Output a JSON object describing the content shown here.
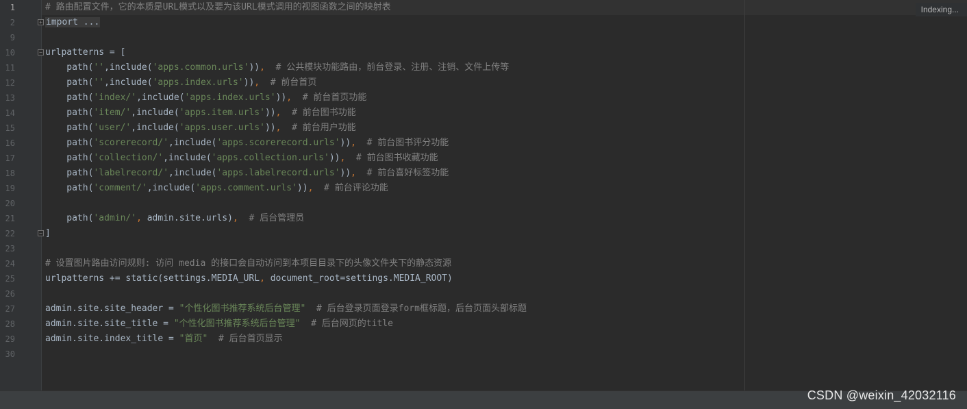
{
  "editor": {
    "line_numbers": [
      "1",
      "2",
      "9",
      "10",
      "11",
      "12",
      "13",
      "14",
      "15",
      "16",
      "17",
      "18",
      "19",
      "20",
      "21",
      "22",
      "23",
      "24",
      "25",
      "26",
      "27",
      "28",
      "29",
      "30"
    ],
    "lines": [
      [
        {
          "c": "cm",
          "t": "# 路由配置文件，它的本质是URL模式以及要为该URL模式调用的视图函数之间的映射表"
        }
      ],
      [
        {
          "c": "import-fold",
          "t": "import ..."
        }
      ],
      [],
      [
        {
          "c": "txt",
          "t": "urlpatterns = ["
        }
      ],
      [
        {
          "c": "txt",
          "t": "    path("
        },
        {
          "c": "str",
          "t": "''"
        },
        {
          "c": "txt",
          "t": ",include("
        },
        {
          "c": "str",
          "t": "'apps.common.urls'"
        },
        {
          "c": "txt",
          "t": "))"
        },
        {
          "c": "kw",
          "t": ","
        },
        {
          "c": "txt",
          "t": "  "
        },
        {
          "c": "cm",
          "t": "# 公共模块功能路由，前台登录、注册、注销、文件上传等"
        }
      ],
      [
        {
          "c": "txt",
          "t": "    path("
        },
        {
          "c": "str",
          "t": "''"
        },
        {
          "c": "txt",
          "t": ",include("
        },
        {
          "c": "str",
          "t": "'apps.index.urls'"
        },
        {
          "c": "txt",
          "t": "))"
        },
        {
          "c": "kw",
          "t": ","
        },
        {
          "c": "txt",
          "t": "  "
        },
        {
          "c": "cm",
          "t": "# 前台首页"
        }
      ],
      [
        {
          "c": "txt",
          "t": "    path("
        },
        {
          "c": "str",
          "t": "'index/'"
        },
        {
          "c": "txt",
          "t": ",include("
        },
        {
          "c": "str",
          "t": "'apps.index.urls'"
        },
        {
          "c": "txt",
          "t": "))"
        },
        {
          "c": "kw",
          "t": ","
        },
        {
          "c": "txt",
          "t": "  "
        },
        {
          "c": "cm",
          "t": "# 前台首页功能"
        }
      ],
      [
        {
          "c": "txt",
          "t": "    path("
        },
        {
          "c": "str",
          "t": "'item/'"
        },
        {
          "c": "txt",
          "t": ",include("
        },
        {
          "c": "str",
          "t": "'apps.item.urls'"
        },
        {
          "c": "txt",
          "t": "))"
        },
        {
          "c": "kw",
          "t": ","
        },
        {
          "c": "txt",
          "t": "  "
        },
        {
          "c": "cm",
          "t": "# 前台图书功能"
        }
      ],
      [
        {
          "c": "txt",
          "t": "    path("
        },
        {
          "c": "str",
          "t": "'user/'"
        },
        {
          "c": "txt",
          "t": ",include("
        },
        {
          "c": "str",
          "t": "'apps.user.urls'"
        },
        {
          "c": "txt",
          "t": "))"
        },
        {
          "c": "kw",
          "t": ","
        },
        {
          "c": "txt",
          "t": "  "
        },
        {
          "c": "cm",
          "t": "# 前台用户功能"
        }
      ],
      [
        {
          "c": "txt",
          "t": "    path("
        },
        {
          "c": "str",
          "t": "'scorerecord/'"
        },
        {
          "c": "txt",
          "t": ",include("
        },
        {
          "c": "str",
          "t": "'apps.scorerecord.urls'"
        },
        {
          "c": "txt",
          "t": "))"
        },
        {
          "c": "kw",
          "t": ","
        },
        {
          "c": "txt",
          "t": "  "
        },
        {
          "c": "cm",
          "t": "# 前台图书评分功能"
        }
      ],
      [
        {
          "c": "txt",
          "t": "    path("
        },
        {
          "c": "str",
          "t": "'collection/'"
        },
        {
          "c": "txt",
          "t": ",include("
        },
        {
          "c": "str",
          "t": "'apps.collection.urls'"
        },
        {
          "c": "txt",
          "t": "))"
        },
        {
          "c": "kw",
          "t": ","
        },
        {
          "c": "txt",
          "t": "  "
        },
        {
          "c": "cm",
          "t": "# 前台图书收藏功能"
        }
      ],
      [
        {
          "c": "txt",
          "t": "    path("
        },
        {
          "c": "str",
          "t": "'labelrecord/'"
        },
        {
          "c": "txt",
          "t": ",include("
        },
        {
          "c": "str",
          "t": "'apps.labelrecord.urls'"
        },
        {
          "c": "txt",
          "t": "))"
        },
        {
          "c": "kw",
          "t": ","
        },
        {
          "c": "txt",
          "t": "  "
        },
        {
          "c": "cm",
          "t": "# 前台喜好标签功能"
        }
      ],
      [
        {
          "c": "txt",
          "t": "    path("
        },
        {
          "c": "str",
          "t": "'comment/'"
        },
        {
          "c": "txt",
          "t": ",include("
        },
        {
          "c": "str",
          "t": "'apps.comment.urls'"
        },
        {
          "c": "txt",
          "t": "))"
        },
        {
          "c": "kw",
          "t": ","
        },
        {
          "c": "txt",
          "t": "  "
        },
        {
          "c": "cm",
          "t": "# 前台评论功能"
        }
      ],
      [],
      [
        {
          "c": "txt",
          "t": "    path("
        },
        {
          "c": "str",
          "t": "'admin/'"
        },
        {
          "c": "kw",
          "t": ","
        },
        {
          "c": "txt",
          "t": " admin.site.urls)"
        },
        {
          "c": "kw",
          "t": ","
        },
        {
          "c": "txt",
          "t": "  "
        },
        {
          "c": "cm",
          "t": "# 后台管理员"
        }
      ],
      [
        {
          "c": "txt",
          "t": "]"
        }
      ],
      [],
      [
        {
          "c": "cm",
          "t": "# 设置图片路由访问规则: 访问 media 的接口会自动访问到本项目目录下的头像文件夹下的静态资源"
        }
      ],
      [
        {
          "c": "txt",
          "t": "urlpatterns += static(settings.MEDIA_URL"
        },
        {
          "c": "kw",
          "t": ","
        },
        {
          "c": "txt",
          "t": " document_root=settings.MEDIA_ROOT)"
        }
      ],
      [],
      [
        {
          "c": "txt",
          "t": "admin.site.site_header = "
        },
        {
          "c": "str",
          "t": "\"个性化图书推荐系统后台管理\""
        },
        {
          "c": "txt",
          "t": "  "
        },
        {
          "c": "cm",
          "t": "# 后台登录页面登录form框标题，后台页面头部标题"
        }
      ],
      [
        {
          "c": "txt",
          "t": "admin.site.site_title = "
        },
        {
          "c": "str",
          "t": "\"个性化图书推荐系统后台管理\""
        },
        {
          "c": "txt",
          "t": "  "
        },
        {
          "c": "cm",
          "t": "# 后台网页的title"
        }
      ],
      [
        {
          "c": "txt",
          "t": "admin.site.index_title = "
        },
        {
          "c": "str",
          "t": "\"首页\""
        },
        {
          "c": "txt",
          "t": "  "
        },
        {
          "c": "cm",
          "t": "# 后台首页显示"
        }
      ],
      []
    ],
    "current_line": "1"
  },
  "status": {
    "indexing_label": "Indexing...",
    "watermark": "CSDN @weixin_42032116"
  },
  "colors": {
    "background": "#2b2b2b",
    "gutter": "#313335",
    "comment": "#808080",
    "string": "#6a8759",
    "text": "#a9b7c6",
    "keyword": "#cc7832"
  }
}
